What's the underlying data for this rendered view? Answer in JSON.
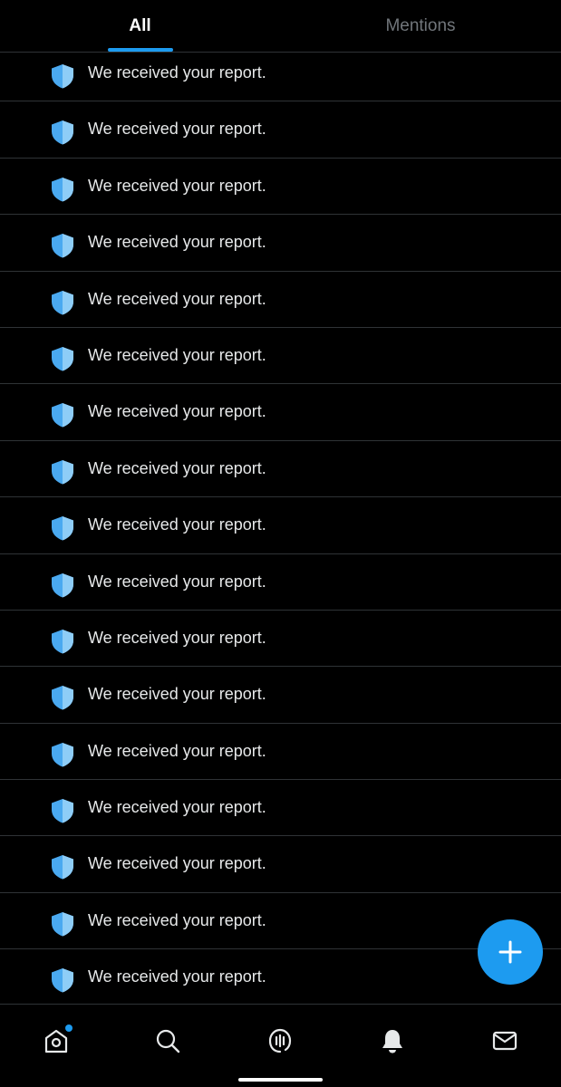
{
  "tabs": [
    {
      "label": "All",
      "active": true
    },
    {
      "label": "Mentions",
      "active": false
    }
  ],
  "notifications": [
    {
      "icon": "shield-icon",
      "text": "We received your report."
    },
    {
      "icon": "shield-icon",
      "text": "We received your report."
    },
    {
      "icon": "shield-icon",
      "text": "We received your report."
    },
    {
      "icon": "shield-icon",
      "text": "We received your report."
    },
    {
      "icon": "shield-icon",
      "text": "We received your report."
    },
    {
      "icon": "shield-icon",
      "text": "We received your report."
    },
    {
      "icon": "shield-icon",
      "text": "We received your report."
    },
    {
      "icon": "shield-icon",
      "text": "We received your report."
    },
    {
      "icon": "shield-icon",
      "text": "We received your report."
    },
    {
      "icon": "shield-icon",
      "text": "We received your report."
    },
    {
      "icon": "shield-icon",
      "text": "We received your report."
    },
    {
      "icon": "shield-icon",
      "text": "We received your report."
    },
    {
      "icon": "shield-icon",
      "text": "We received your report."
    },
    {
      "icon": "shield-icon",
      "text": "We received your report."
    },
    {
      "icon": "shield-icon",
      "text": "We received your report."
    },
    {
      "icon": "shield-icon",
      "text": "We received your report."
    },
    {
      "icon": "shield-icon",
      "text": "We received your report."
    }
  ],
  "fab": {
    "icon": "plus-icon"
  },
  "bottom_nav": [
    {
      "icon": "home-icon",
      "has_badge": true
    },
    {
      "icon": "search-icon"
    },
    {
      "icon": "spaces-icon"
    },
    {
      "icon": "bell-icon",
      "active": true
    },
    {
      "icon": "mail-icon"
    }
  ],
  "colors": {
    "background": "#000000",
    "accent": "#1d9bf0",
    "divider": "#2f3336",
    "text_primary": "#e7e9ea",
    "text_secondary": "#71767b"
  }
}
